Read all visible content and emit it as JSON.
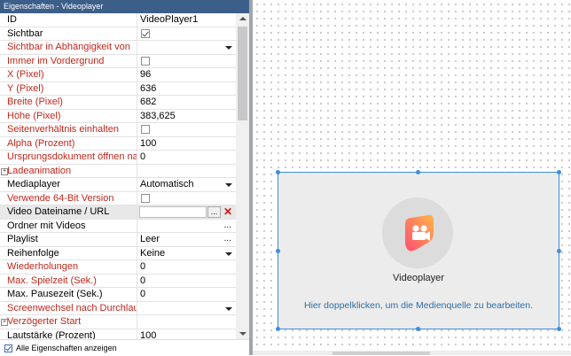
{
  "panel": {
    "title": "Eigenschaften - Videoplayer",
    "rows": [
      {
        "name": "ID",
        "value": "VideoPlayer1",
        "style": "blk",
        "kind": "text"
      },
      {
        "name": "Sichtbar",
        "value": "",
        "style": "blk",
        "kind": "checkbox",
        "checked": true
      },
      {
        "name": "Sichtbar in Abhängigkeit von",
        "value": "",
        "style": "red",
        "kind": "dropdown"
      },
      {
        "name": "Immer im Vordergrund",
        "value": "",
        "style": "red",
        "kind": "checkbox",
        "checked": false
      },
      {
        "name": "X (Pixel)",
        "value": "96",
        "style": "red",
        "kind": "text"
      },
      {
        "name": "Y (Pixel)",
        "value": "636",
        "style": "red",
        "kind": "text"
      },
      {
        "name": "Breite (Pixel)",
        "value": "682",
        "style": "red",
        "kind": "text"
      },
      {
        "name": "Höhe (Pixel)",
        "value": "383,625",
        "style": "red",
        "kind": "text"
      },
      {
        "name": "Seitenverhältnis einhalten",
        "value": "",
        "style": "red",
        "kind": "checkbox",
        "checked": false
      },
      {
        "name": "Alpha (Prozent)",
        "value": "100",
        "style": "red",
        "kind": "text"
      },
      {
        "name": "Ursprungsdokument öffnen na",
        "value": "0",
        "style": "red",
        "kind": "text"
      },
      {
        "name": "Ladeanimation",
        "value": "",
        "style": "red",
        "kind": "group"
      },
      {
        "name": "Mediaplayer",
        "value": "Automatisch",
        "style": "blk",
        "kind": "dropdown"
      },
      {
        "name": "Verwende 64-Bit Version",
        "value": "",
        "style": "red",
        "kind": "checkbox",
        "checked": false
      },
      {
        "name": "Video Dateiname / URL",
        "value": "",
        "style": "blk",
        "kind": "file",
        "selected": true
      },
      {
        "name": "Ordner mit Videos",
        "value": "",
        "style": "blk",
        "kind": "ellipsis"
      },
      {
        "name": "Playlist",
        "value": "Leer",
        "style": "blk",
        "kind": "ellipsis"
      },
      {
        "name": "Reihenfolge",
        "value": "Keine",
        "style": "blk",
        "kind": "dropdown"
      },
      {
        "name": "Wiederholungen",
        "value": "0",
        "style": "red",
        "kind": "text"
      },
      {
        "name": "Max. Spielzeit (Sek.)",
        "value": "0",
        "style": "red",
        "kind": "text"
      },
      {
        "name": "Max. Pausezeit (Sek.)",
        "value": "0",
        "style": "blk",
        "kind": "text"
      },
      {
        "name": "Screenwechsel nach Durchlau",
        "value": "",
        "style": "red",
        "kind": "dropdown"
      },
      {
        "name": "Verzögerter Start",
        "value": "",
        "style": "red",
        "kind": "group"
      },
      {
        "name": "Lautstärke (Prozent)",
        "value": "100",
        "style": "blk",
        "kind": "text"
      }
    ],
    "footer_label": "Alle Eigenschaften anzeigen",
    "footer_checked": true
  },
  "widget": {
    "label": "Videoplayer",
    "hint": "Hier doppelklicken, um die Medienquelle zu bearbeiten.",
    "icon": "video-camera-icon"
  },
  "colors": {
    "accent": "#3b8fde",
    "required_label": "#c0271b",
    "hint_text": "#2e6da4",
    "icon_gradient_start": "#ff5a6e",
    "icon_gradient_end": "#ffb347"
  }
}
